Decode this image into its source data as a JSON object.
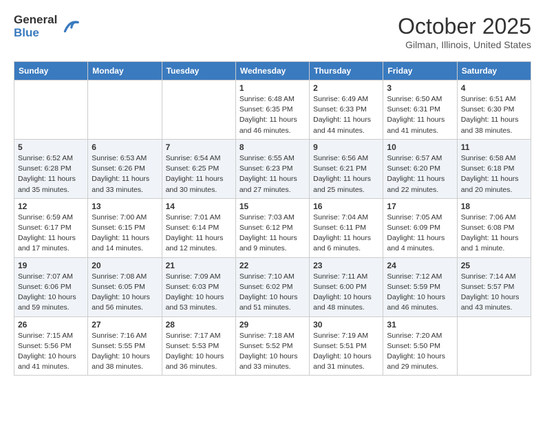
{
  "header": {
    "logo_general": "General",
    "logo_blue": "Blue",
    "month": "October 2025",
    "location": "Gilman, Illinois, United States"
  },
  "weekdays": [
    "Sunday",
    "Monday",
    "Tuesday",
    "Wednesday",
    "Thursday",
    "Friday",
    "Saturday"
  ],
  "weeks": [
    [
      {
        "day": "",
        "info": ""
      },
      {
        "day": "",
        "info": ""
      },
      {
        "day": "",
        "info": ""
      },
      {
        "day": "1",
        "info": "Sunrise: 6:48 AM\nSunset: 6:35 PM\nDaylight: 11 hours and 46 minutes."
      },
      {
        "day": "2",
        "info": "Sunrise: 6:49 AM\nSunset: 6:33 PM\nDaylight: 11 hours and 44 minutes."
      },
      {
        "day": "3",
        "info": "Sunrise: 6:50 AM\nSunset: 6:31 PM\nDaylight: 11 hours and 41 minutes."
      },
      {
        "day": "4",
        "info": "Sunrise: 6:51 AM\nSunset: 6:30 PM\nDaylight: 11 hours and 38 minutes."
      }
    ],
    [
      {
        "day": "5",
        "info": "Sunrise: 6:52 AM\nSunset: 6:28 PM\nDaylight: 11 hours and 35 minutes."
      },
      {
        "day": "6",
        "info": "Sunrise: 6:53 AM\nSunset: 6:26 PM\nDaylight: 11 hours and 33 minutes."
      },
      {
        "day": "7",
        "info": "Sunrise: 6:54 AM\nSunset: 6:25 PM\nDaylight: 11 hours and 30 minutes."
      },
      {
        "day": "8",
        "info": "Sunrise: 6:55 AM\nSunset: 6:23 PM\nDaylight: 11 hours and 27 minutes."
      },
      {
        "day": "9",
        "info": "Sunrise: 6:56 AM\nSunset: 6:21 PM\nDaylight: 11 hours and 25 minutes."
      },
      {
        "day": "10",
        "info": "Sunrise: 6:57 AM\nSunset: 6:20 PM\nDaylight: 11 hours and 22 minutes."
      },
      {
        "day": "11",
        "info": "Sunrise: 6:58 AM\nSunset: 6:18 PM\nDaylight: 11 hours and 20 minutes."
      }
    ],
    [
      {
        "day": "12",
        "info": "Sunrise: 6:59 AM\nSunset: 6:17 PM\nDaylight: 11 hours and 17 minutes."
      },
      {
        "day": "13",
        "info": "Sunrise: 7:00 AM\nSunset: 6:15 PM\nDaylight: 11 hours and 14 minutes."
      },
      {
        "day": "14",
        "info": "Sunrise: 7:01 AM\nSunset: 6:14 PM\nDaylight: 11 hours and 12 minutes."
      },
      {
        "day": "15",
        "info": "Sunrise: 7:03 AM\nSunset: 6:12 PM\nDaylight: 11 hours and 9 minutes."
      },
      {
        "day": "16",
        "info": "Sunrise: 7:04 AM\nSunset: 6:11 PM\nDaylight: 11 hours and 6 minutes."
      },
      {
        "day": "17",
        "info": "Sunrise: 7:05 AM\nSunset: 6:09 PM\nDaylight: 11 hours and 4 minutes."
      },
      {
        "day": "18",
        "info": "Sunrise: 7:06 AM\nSunset: 6:08 PM\nDaylight: 11 hours and 1 minute."
      }
    ],
    [
      {
        "day": "19",
        "info": "Sunrise: 7:07 AM\nSunset: 6:06 PM\nDaylight: 10 hours and 59 minutes."
      },
      {
        "day": "20",
        "info": "Sunrise: 7:08 AM\nSunset: 6:05 PM\nDaylight: 10 hours and 56 minutes."
      },
      {
        "day": "21",
        "info": "Sunrise: 7:09 AM\nSunset: 6:03 PM\nDaylight: 10 hours and 53 minutes."
      },
      {
        "day": "22",
        "info": "Sunrise: 7:10 AM\nSunset: 6:02 PM\nDaylight: 10 hours and 51 minutes."
      },
      {
        "day": "23",
        "info": "Sunrise: 7:11 AM\nSunset: 6:00 PM\nDaylight: 10 hours and 48 minutes."
      },
      {
        "day": "24",
        "info": "Sunrise: 7:12 AM\nSunset: 5:59 PM\nDaylight: 10 hours and 46 minutes."
      },
      {
        "day": "25",
        "info": "Sunrise: 7:14 AM\nSunset: 5:57 PM\nDaylight: 10 hours and 43 minutes."
      }
    ],
    [
      {
        "day": "26",
        "info": "Sunrise: 7:15 AM\nSunset: 5:56 PM\nDaylight: 10 hours and 41 minutes."
      },
      {
        "day": "27",
        "info": "Sunrise: 7:16 AM\nSunset: 5:55 PM\nDaylight: 10 hours and 38 minutes."
      },
      {
        "day": "28",
        "info": "Sunrise: 7:17 AM\nSunset: 5:53 PM\nDaylight: 10 hours and 36 minutes."
      },
      {
        "day": "29",
        "info": "Sunrise: 7:18 AM\nSunset: 5:52 PM\nDaylight: 10 hours and 33 minutes."
      },
      {
        "day": "30",
        "info": "Sunrise: 7:19 AM\nSunset: 5:51 PM\nDaylight: 10 hours and 31 minutes."
      },
      {
        "day": "31",
        "info": "Sunrise: 7:20 AM\nSunset: 5:50 PM\nDaylight: 10 hours and 29 minutes."
      },
      {
        "day": "",
        "info": ""
      }
    ]
  ]
}
